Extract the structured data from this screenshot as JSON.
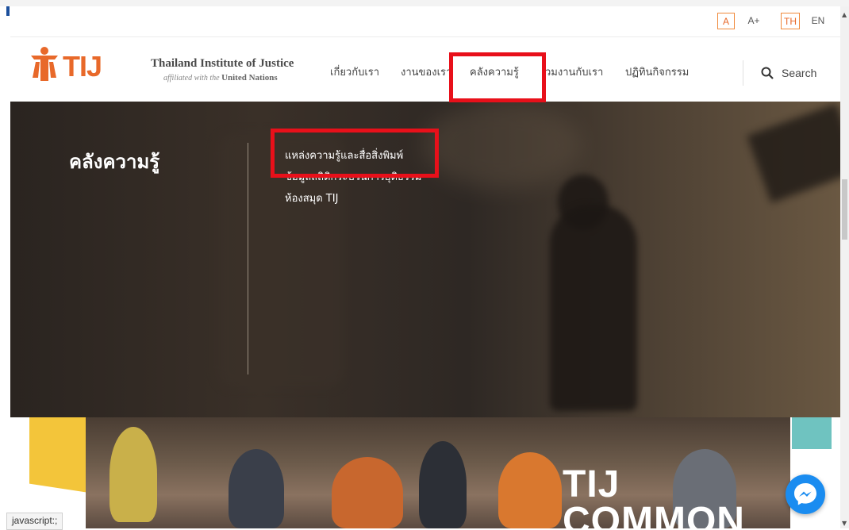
{
  "utility": {
    "font_small": "A",
    "font_large": "A+",
    "lang_th": "TH",
    "lang_en": "EN"
  },
  "logo": {
    "text": "TIJ"
  },
  "brand": {
    "title": "Thailand Institute of Justice",
    "subtitle_prefix": "affiliated with the",
    "subtitle_bold": "United Nations"
  },
  "nav": {
    "items": [
      {
        "label": "เกี่ยวกับเรา"
      },
      {
        "label": "งานของเรา"
      },
      {
        "label": "คลังความรู้"
      },
      {
        "label": "วมงานกับเรา"
      },
      {
        "label": "ปฏิทินกิจกรรม"
      }
    ],
    "search_label": "Search"
  },
  "panel": {
    "title": "คลังความรู้",
    "submenu": [
      {
        "label": "แหล่งความรู้และสื่อสิ่งพิมพ์"
      },
      {
        "label": "ข้อมูลสถิติกระบวนการยุติธรรม"
      },
      {
        "label": "ห้องสมุด TIJ"
      }
    ]
  },
  "hero": {
    "line1": "TIJ",
    "line2": "COMMON"
  },
  "status": {
    "text": "javascript:;"
  },
  "colors": {
    "brand_orange": "#e8692a",
    "highlight_red": "#e8101a",
    "messenger_blue": "#1a8cf0"
  }
}
